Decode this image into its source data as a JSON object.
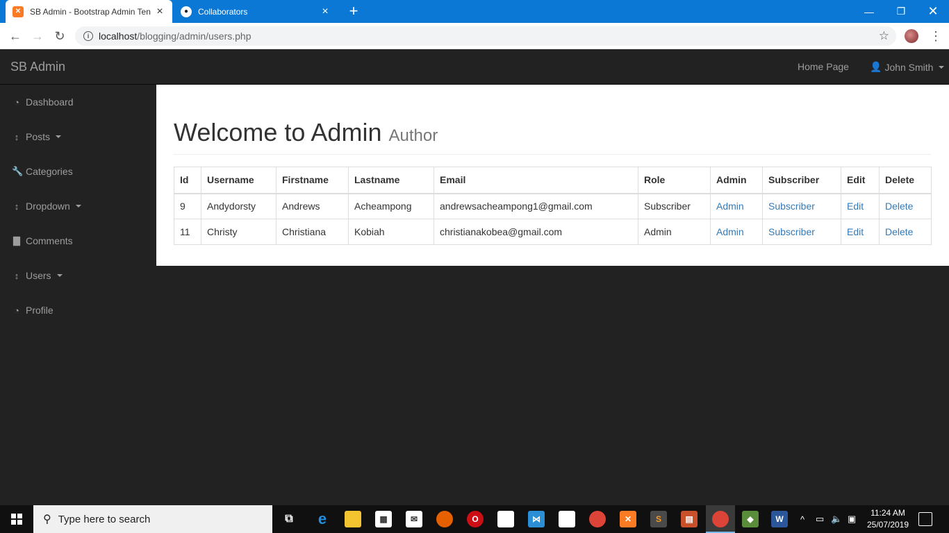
{
  "browser": {
    "tabs": [
      {
        "title": "SB Admin - Bootstrap Admin Ten",
        "active": true
      },
      {
        "title": "Collaborators",
        "active": false
      }
    ],
    "url_host": "localhost",
    "url_path": "/blogging/admin/users.php"
  },
  "navbar": {
    "brand": "SB Admin",
    "home_link": "Home Page",
    "user": "John Smith"
  },
  "sidebar": {
    "items": [
      {
        "label": "Dashboard",
        "icon": "dashboard-icon",
        "dropdown": false
      },
      {
        "label": "Posts",
        "icon": "arrows-v-icon",
        "dropdown": true
      },
      {
        "label": "Categories",
        "icon": "wrench-icon",
        "dropdown": false
      },
      {
        "label": "Dropdown",
        "icon": "arrows-v-icon",
        "dropdown": true
      },
      {
        "label": "Comments",
        "icon": "file-icon",
        "dropdown": false
      },
      {
        "label": "Users",
        "icon": "arrows-v-icon",
        "dropdown": true
      },
      {
        "label": "Profile",
        "icon": "dashboard-icon",
        "dropdown": false
      }
    ]
  },
  "page": {
    "title": "Welcome to Admin",
    "subtitle": "Author"
  },
  "table": {
    "headers": [
      "Id",
      "Username",
      "Firstname",
      "Lastname",
      "Email",
      "Role",
      "Admin",
      "Subscriber",
      "Edit",
      "Delete"
    ],
    "rows": [
      {
        "id": "9",
        "username": "Andydorsty",
        "firstname": "Andrews",
        "lastname": "Acheampong",
        "email": "andrewsacheampong1@gmail.com",
        "role": "Subscriber",
        "admin": "Admin",
        "subscriber": "Subscriber",
        "edit": "Edit",
        "delete": "Delete"
      },
      {
        "id": "11",
        "username": "Christy",
        "firstname": "Christiana",
        "lastname": "Kobiah",
        "email": "christianakobea@gmail.com",
        "role": "Admin",
        "admin": "Admin",
        "subscriber": "Subscriber",
        "edit": "Edit",
        "delete": "Delete"
      }
    ]
  },
  "taskbar": {
    "search_placeholder": "Type here to search",
    "time": "11:24 AM",
    "date": "25/07/2019"
  },
  "colors": {
    "link": "#337ab7",
    "navbar_bg": "#222222",
    "chrome_blue": "#0a78d4"
  }
}
